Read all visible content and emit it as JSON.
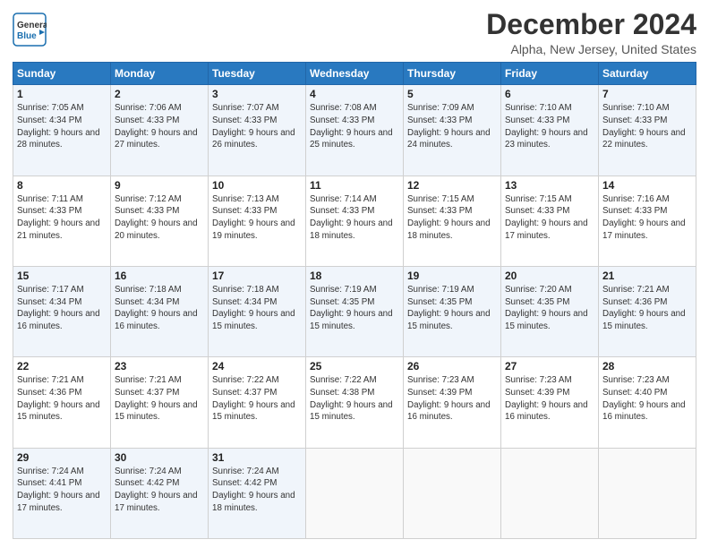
{
  "logo": {
    "line1": "General",
    "line2": "Blue",
    "icon": "▶"
  },
  "title": "December 2024",
  "subtitle": "Alpha, New Jersey, United States",
  "days_of_week": [
    "Sunday",
    "Monday",
    "Tuesday",
    "Wednesday",
    "Thursday",
    "Friday",
    "Saturday"
  ],
  "weeks": [
    [
      {
        "day": "1",
        "sunrise": "7:05 AM",
        "sunset": "4:34 PM",
        "daylight": "9 hours and 28 minutes."
      },
      {
        "day": "2",
        "sunrise": "7:06 AM",
        "sunset": "4:33 PM",
        "daylight": "9 hours and 27 minutes."
      },
      {
        "day": "3",
        "sunrise": "7:07 AM",
        "sunset": "4:33 PM",
        "daylight": "9 hours and 26 minutes."
      },
      {
        "day": "4",
        "sunrise": "7:08 AM",
        "sunset": "4:33 PM",
        "daylight": "9 hours and 25 minutes."
      },
      {
        "day": "5",
        "sunrise": "7:09 AM",
        "sunset": "4:33 PM",
        "daylight": "9 hours and 24 minutes."
      },
      {
        "day": "6",
        "sunrise": "7:10 AM",
        "sunset": "4:33 PM",
        "daylight": "9 hours and 23 minutes."
      },
      {
        "day": "7",
        "sunrise": "7:10 AM",
        "sunset": "4:33 PM",
        "daylight": "9 hours and 22 minutes."
      }
    ],
    [
      {
        "day": "8",
        "sunrise": "7:11 AM",
        "sunset": "4:33 PM",
        "daylight": "9 hours and 21 minutes."
      },
      {
        "day": "9",
        "sunrise": "7:12 AM",
        "sunset": "4:33 PM",
        "daylight": "9 hours and 20 minutes."
      },
      {
        "day": "10",
        "sunrise": "7:13 AM",
        "sunset": "4:33 PM",
        "daylight": "9 hours and 19 minutes."
      },
      {
        "day": "11",
        "sunrise": "7:14 AM",
        "sunset": "4:33 PM",
        "daylight": "9 hours and 18 minutes."
      },
      {
        "day": "12",
        "sunrise": "7:15 AM",
        "sunset": "4:33 PM",
        "daylight": "9 hours and 18 minutes."
      },
      {
        "day": "13",
        "sunrise": "7:15 AM",
        "sunset": "4:33 PM",
        "daylight": "9 hours and 17 minutes."
      },
      {
        "day": "14",
        "sunrise": "7:16 AM",
        "sunset": "4:33 PM",
        "daylight": "9 hours and 17 minutes."
      }
    ],
    [
      {
        "day": "15",
        "sunrise": "7:17 AM",
        "sunset": "4:34 PM",
        "daylight": "9 hours and 16 minutes."
      },
      {
        "day": "16",
        "sunrise": "7:18 AM",
        "sunset": "4:34 PM",
        "daylight": "9 hours and 16 minutes."
      },
      {
        "day": "17",
        "sunrise": "7:18 AM",
        "sunset": "4:34 PM",
        "daylight": "9 hours and 15 minutes."
      },
      {
        "day": "18",
        "sunrise": "7:19 AM",
        "sunset": "4:35 PM",
        "daylight": "9 hours and 15 minutes."
      },
      {
        "day": "19",
        "sunrise": "7:19 AM",
        "sunset": "4:35 PM",
        "daylight": "9 hours and 15 minutes."
      },
      {
        "day": "20",
        "sunrise": "7:20 AM",
        "sunset": "4:35 PM",
        "daylight": "9 hours and 15 minutes."
      },
      {
        "day": "21",
        "sunrise": "7:21 AM",
        "sunset": "4:36 PM",
        "daylight": "9 hours and 15 minutes."
      }
    ],
    [
      {
        "day": "22",
        "sunrise": "7:21 AM",
        "sunset": "4:36 PM",
        "daylight": "9 hours and 15 minutes."
      },
      {
        "day": "23",
        "sunrise": "7:21 AM",
        "sunset": "4:37 PM",
        "daylight": "9 hours and 15 minutes."
      },
      {
        "day": "24",
        "sunrise": "7:22 AM",
        "sunset": "4:37 PM",
        "daylight": "9 hours and 15 minutes."
      },
      {
        "day": "25",
        "sunrise": "7:22 AM",
        "sunset": "4:38 PM",
        "daylight": "9 hours and 15 minutes."
      },
      {
        "day": "26",
        "sunrise": "7:23 AM",
        "sunset": "4:39 PM",
        "daylight": "9 hours and 16 minutes."
      },
      {
        "day": "27",
        "sunrise": "7:23 AM",
        "sunset": "4:39 PM",
        "daylight": "9 hours and 16 minutes."
      },
      {
        "day": "28",
        "sunrise": "7:23 AM",
        "sunset": "4:40 PM",
        "daylight": "9 hours and 16 minutes."
      }
    ],
    [
      {
        "day": "29",
        "sunrise": "7:24 AM",
        "sunset": "4:41 PM",
        "daylight": "9 hours and 17 minutes."
      },
      {
        "day": "30",
        "sunrise": "7:24 AM",
        "sunset": "4:42 PM",
        "daylight": "9 hours and 17 minutes."
      },
      {
        "day": "31",
        "sunrise": "7:24 AM",
        "sunset": "4:42 PM",
        "daylight": "9 hours and 18 minutes."
      },
      null,
      null,
      null,
      null
    ]
  ],
  "labels": {
    "sunrise": "Sunrise: ",
    "sunset": "Sunset: ",
    "daylight": "Daylight: "
  }
}
